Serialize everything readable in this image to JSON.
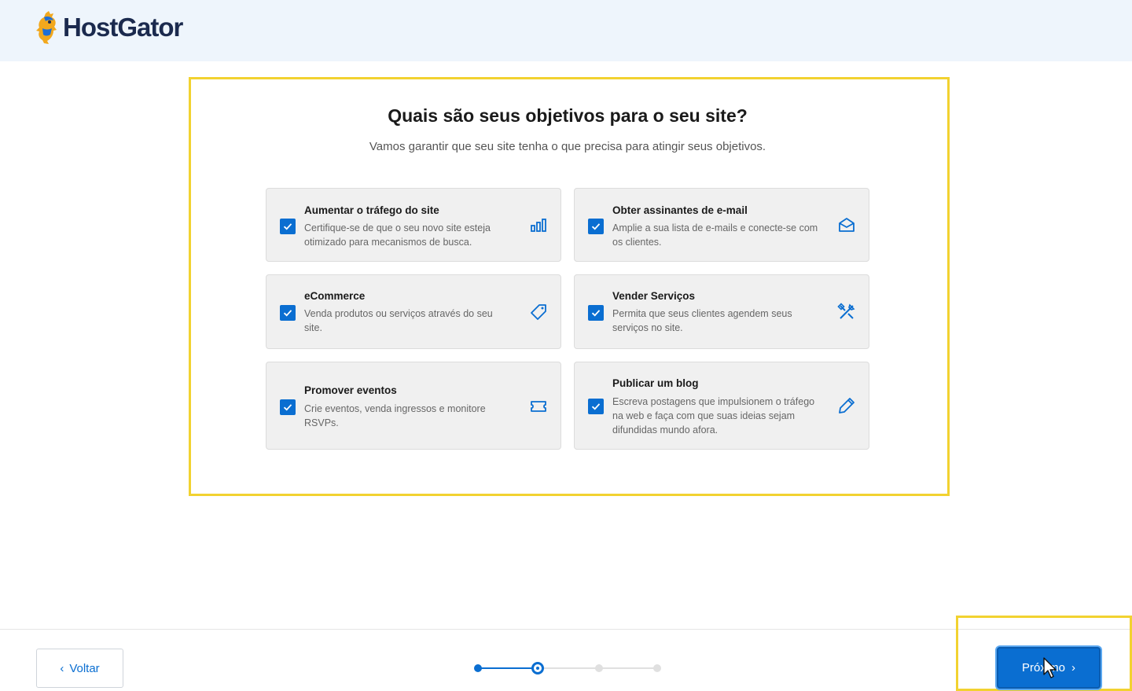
{
  "brand": {
    "name": "HostGator"
  },
  "page": {
    "title": "Quais são seus objetivos para o seu site?",
    "subtitle": "Vamos garantir que seu site tenha o que precisa para atingir seus objetivos."
  },
  "goals": [
    {
      "title": "Aumentar o tráfego do site",
      "description": "Certifique-se de que o seu novo site esteja otimizado para mecanismos de busca.",
      "checked": true,
      "icon": "bar-chart-icon"
    },
    {
      "title": "Obter assinantes de e-mail",
      "description": "Amplie a sua lista de e-mails e conecte-se com os clientes.",
      "checked": true,
      "icon": "envelope-open-icon"
    },
    {
      "title": "eCommerce",
      "description": "Venda produtos ou serviços através do seu site.",
      "checked": true,
      "icon": "price-tag-icon"
    },
    {
      "title": "Vender Serviços",
      "description": "Permita que seus clientes agendem seus serviços no site.",
      "checked": true,
      "icon": "tools-icon"
    },
    {
      "title": "Promover eventos",
      "description": "Crie eventos, venda ingressos e monitore RSVPs.",
      "checked": true,
      "icon": "ticket-icon"
    },
    {
      "title": "Publicar um blog",
      "description": "Escreva postagens que impulsionem o tráfego na web e faça com que suas ideias sejam difundidas mundo afora.",
      "checked": true,
      "icon": "pencil-icon"
    }
  ],
  "footer": {
    "back_label": "Voltar",
    "next_label": "Próximo",
    "steps_total": 4,
    "current_step": 2
  },
  "colors": {
    "accent": "#0a6ed1",
    "highlight": "#f2d230",
    "header_bg": "#eef5fc",
    "card_bg": "#f0f0f0"
  }
}
